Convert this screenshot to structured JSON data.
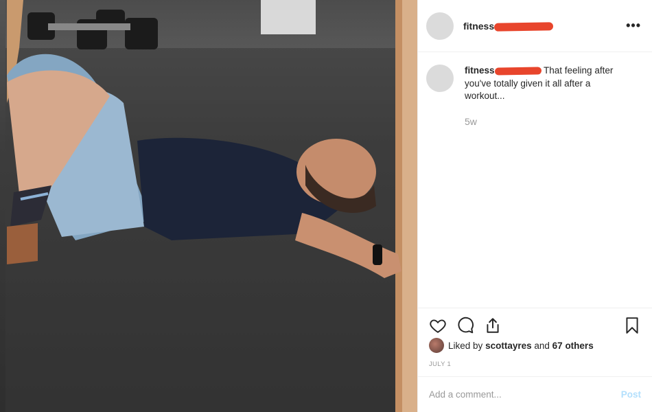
{
  "post": {
    "username_visible": "fitness",
    "more_icon": "ellipsis-icon",
    "caption": {
      "username_visible": "fitness",
      "text": " That feeling after you've totally given it all after a workout..."
    },
    "time_ago": "5w",
    "likes": {
      "prefix": "Liked by ",
      "user": "scottayres",
      "middle": " and ",
      "others": "67 others"
    },
    "date": "JULY 1",
    "comment_placeholder": "Add a comment...",
    "post_label": "Post"
  },
  "icons": [
    "heart-icon",
    "comment-icon",
    "share-icon",
    "bookmark-icon"
  ],
  "colors": {
    "redaction": "#e8452c",
    "post_disabled": "#b2dffc",
    "muted": "#999999"
  }
}
